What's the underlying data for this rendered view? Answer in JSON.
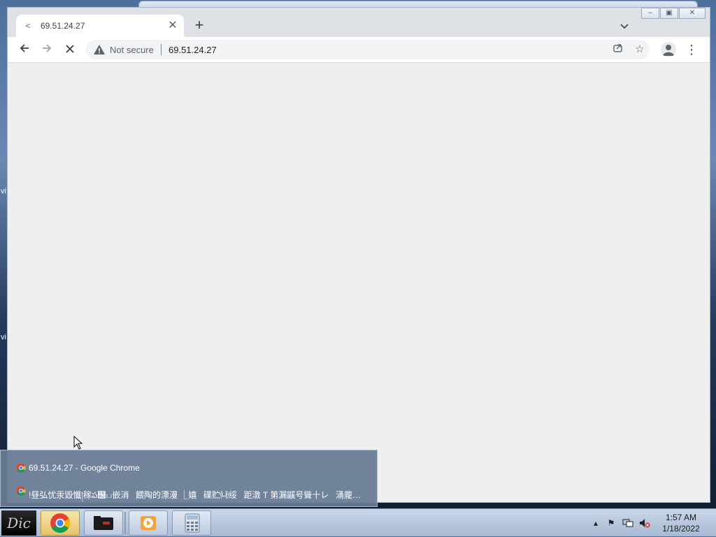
{
  "browser": {
    "tab": {
      "title": "69.51.24.27"
    },
    "address": {
      "security_label": "Not secure",
      "url": "69.51.24.27"
    }
  },
  "desktop": {
    "partial_labels": [
      "vi",
      "vi"
    ]
  },
  "taskbar_popup": {
    "items": [
      {
        "label": "69.51.24.27 - Google Chrome"
      },
      {
        "label": "!昼弘忧汞毀懺།稼ప஠ப嵌消餵陶的漂漫 ⎿嬉礏贮㈏绥距潡 T 第漏鼷号聳十レ涌龎邑漏屯..."
      }
    ]
  },
  "system_tray": {
    "time": "1:57 AM",
    "date": "1/18/2022"
  }
}
